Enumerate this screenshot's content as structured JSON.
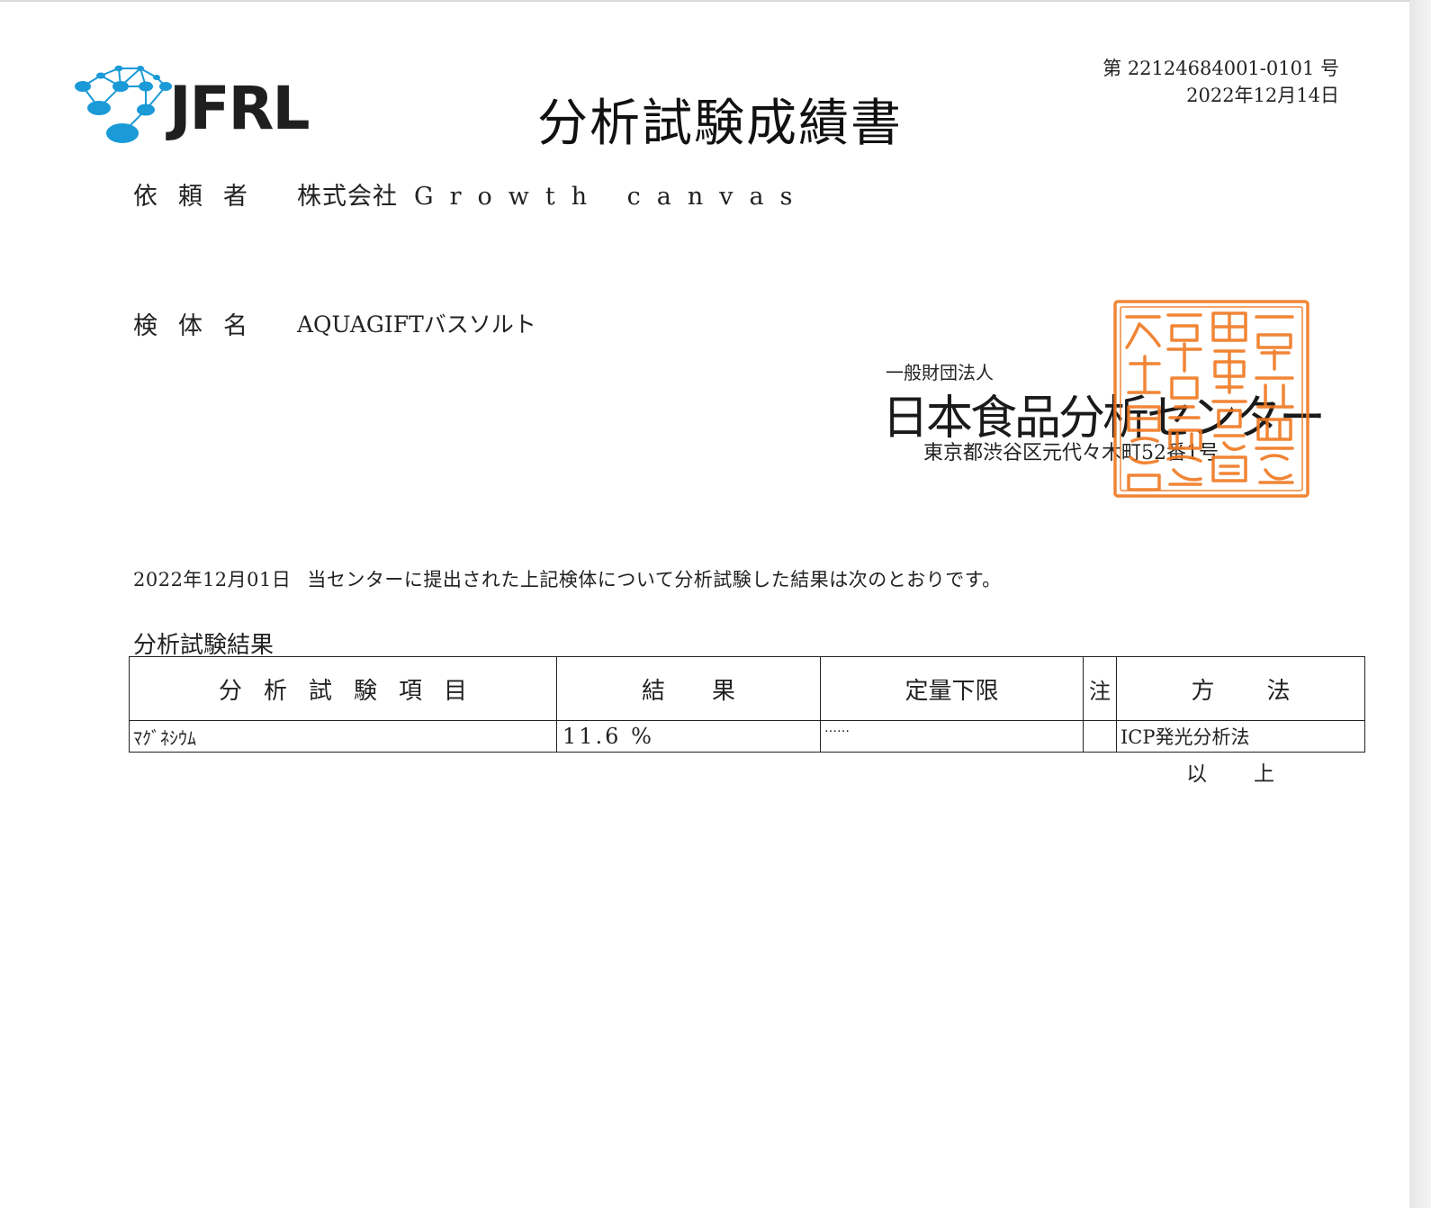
{
  "header": {
    "logo_text": "JFRL",
    "title": "分析試験成績書",
    "document_number": "第 22124684001-0101 号",
    "issue_date": "2022年12月14日"
  },
  "requester": {
    "label": "依頼者",
    "company": "株式会社",
    "name": "Growth canvas"
  },
  "sample": {
    "label": "検体名",
    "name": "AQUAGIFTバスソルト"
  },
  "issuer": {
    "prefix": "一般財団法人",
    "name": "日本食品分析センター",
    "address": "東京都渋谷区元代々木町52番1号",
    "seal_text": "一般財団法人日本食品分析センター之印",
    "seal_color": "#f07820"
  },
  "statement": {
    "date": "2022年12月01日",
    "text": "当センターに提出された上記検体について分析試験した結果は次のとおりです。"
  },
  "results": {
    "section_title": "分析試験結果",
    "columns": [
      "分析試験項目",
      "結果",
      "定量下限",
      "注",
      "方法"
    ],
    "rows": [
      {
        "item": "ﾏｸﾞﾈｼｳﾑ",
        "result": "11.6 %",
        "limit": "……",
        "note": "",
        "method": "ICP発光分析法"
      }
    ]
  },
  "end_mark": "以上",
  "colors": {
    "logo_blue": "#1a9ad7",
    "seal_orange": "#f07820",
    "text": "#222222"
  }
}
